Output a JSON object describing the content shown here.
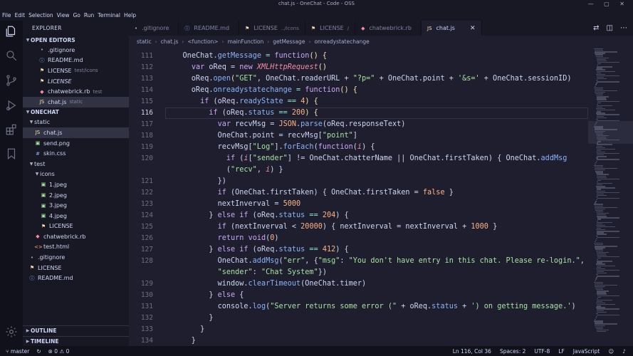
{
  "window": {
    "title": "chat.js - OneChat - Code - OSS",
    "controls": "— ▢ ✕"
  },
  "menu": [
    "File",
    "Edit",
    "Selection",
    "View",
    "Go",
    "Run",
    "Terminal",
    "Help"
  ],
  "sidebar": {
    "header": "EXPLORER",
    "open_editors_title": "OPEN EDITORS",
    "open_editors": [
      {
        "name": ".gitignore",
        "desc": "",
        "icon": "•",
        "color": "#a6adc8"
      },
      {
        "name": "README.md",
        "desc": "",
        "icon": "ⓘ",
        "color": "#89b4fa"
      },
      {
        "name": "LICENSE",
        "desc": "test/icons",
        "icon": "⚑",
        "color": "#f9e2af"
      },
      {
        "name": "LICENSE",
        "desc": "",
        "icon": "⚑",
        "color": "#f9e2af",
        "italic": true
      },
      {
        "name": "chatwebrick.rb",
        "desc": "test",
        "icon": "◆",
        "color": "#f38ba8"
      },
      {
        "name": "chat.js",
        "desc": "static",
        "icon": "JS",
        "color": "#f9e2af"
      }
    ],
    "project_title": "ONECHAT",
    "tree": [
      {
        "depth": 1,
        "type": "folder",
        "name": "static"
      },
      {
        "depth": 2,
        "type": "file",
        "name": "chat.js",
        "icon": "JS",
        "color": "#f9e2af"
      },
      {
        "depth": 2,
        "type": "file",
        "name": "send.png",
        "icon": "▣",
        "color": "#a6e3a1"
      },
      {
        "depth": 2,
        "type": "file",
        "name": "skin.css",
        "icon": "#",
        "color": "#89b4fa"
      },
      {
        "depth": 1,
        "type": "folder",
        "name": "test"
      },
      {
        "depth": 2,
        "type": "folder",
        "name": "icons"
      },
      {
        "depth": 3,
        "type": "file",
        "name": "1.jpeg",
        "icon": "▣",
        "color": "#a6e3a1"
      },
      {
        "depth": 3,
        "type": "file",
        "name": "2.jpeg",
        "icon": "▣",
        "color": "#a6e3a1"
      },
      {
        "depth": 3,
        "type": "file",
        "name": "3.jpeg",
        "icon": "▣",
        "color": "#a6e3a1"
      },
      {
        "depth": 3,
        "type": "file",
        "name": "4.jpeg",
        "icon": "▣",
        "color": "#a6e3a1"
      },
      {
        "depth": 3,
        "type": "file",
        "name": "LICENSE",
        "icon": "⚑",
        "color": "#f9e2af"
      },
      {
        "depth": 2,
        "type": "file",
        "name": "chatwebrick.rb",
        "icon": "◆",
        "color": "#f38ba8"
      },
      {
        "depth": 2,
        "type": "file",
        "name": "test.html",
        "icon": "<>",
        "color": "#fab387"
      },
      {
        "depth": 1,
        "type": "file",
        "name": ".gitignore",
        "icon": "•",
        "color": "#a6adc8"
      },
      {
        "depth": 1,
        "type": "file",
        "name": "LICENSE",
        "icon": "⚑",
        "color": "#f9e2af"
      },
      {
        "depth": 1,
        "type": "file",
        "name": "README.md",
        "icon": "ⓘ",
        "color": "#89b4fa"
      }
    ],
    "outline": "OUTLINE",
    "timeline": "TIMELINE"
  },
  "tabs": [
    {
      "name": ".gitignore",
      "desc": "",
      "icon": "•",
      "color": "#a6adc8"
    },
    {
      "name": "README.md",
      "desc": "",
      "icon": "ⓘ",
      "color": "#89b4fa"
    },
    {
      "name": "LICENSE",
      "desc": "../icons",
      "icon": "⚑",
      "color": "#f9e2af"
    },
    {
      "name": "LICENSE",
      "desc": "/",
      "icon": "⚑",
      "color": "#f9e2af"
    },
    {
      "name": "chatwebrick.rb",
      "desc": "",
      "icon": "◆",
      "color": "#f38ba8"
    },
    {
      "name": "chat.js",
      "desc": "",
      "icon": "JS",
      "color": "#f9e2af",
      "active": true
    }
  ],
  "breadcrumb": [
    "static",
    "chat.js",
    "<function>",
    "mainFunction",
    "getMessage",
    "onreadystatechange"
  ],
  "editor": {
    "current_line": 116,
    "lines": [
      {
        "n": "111",
        "code": [
          [
            "    ",
            ""
          ],
          [
            "OneChat",
            ""
          ],
          [
            ".",
            ""
          ],
          [
            "getMessage",
            "f"
          ],
          [
            " = ",
            "p"
          ],
          [
            "function",
            "k"
          ],
          [
            "() {",
            "y"
          ]
        ]
      },
      {
        "n": "112",
        "code": [
          [
            "      ",
            ""
          ],
          [
            "var",
            "k"
          ],
          [
            " oReq = ",
            ""
          ],
          [
            "new",
            "k"
          ],
          [
            " ",
            ""
          ],
          [
            "XMLHttpRequest",
            "v"
          ],
          [
            "()",
            "y"
          ]
        ]
      },
      {
        "n": "113",
        "code": [
          [
            "      oReq.",
            ""
          ],
          [
            "open",
            "f"
          ],
          [
            "(",
            "y"
          ],
          [
            "\"GET\"",
            "s"
          ],
          [
            ", OneChat.readerURL + ",
            ""
          ],
          [
            "\"?p=\"",
            "s"
          ],
          [
            " + OneChat.point + ",
            ""
          ],
          [
            "'&s='",
            "s"
          ],
          [
            " + OneChat.sessionID)",
            ""
          ]
        ]
      },
      {
        "n": "114",
        "code": [
          [
            "      oReq.",
            ""
          ],
          [
            "onreadystatechange",
            "f"
          ],
          [
            " = ",
            "p"
          ],
          [
            "function",
            "k"
          ],
          [
            "() {",
            "y"
          ]
        ]
      },
      {
        "n": "115",
        "code": [
          [
            "        ",
            ""
          ],
          [
            "if",
            "k"
          ],
          [
            " (oReq.",
            ""
          ],
          [
            "readyState",
            "f"
          ],
          [
            " == ",
            "p"
          ],
          [
            "4",
            "n"
          ],
          [
            ") {",
            "y"
          ]
        ]
      },
      {
        "n": "116",
        "code": [
          [
            "          ",
            ""
          ],
          [
            "if",
            "k"
          ],
          [
            " (oReq.",
            ""
          ],
          [
            "status",
            "f"
          ],
          [
            " == ",
            "p"
          ],
          [
            "200",
            "n"
          ],
          [
            ") {",
            "y"
          ]
        ]
      },
      {
        "n": "117",
        "code": [
          [
            "            ",
            ""
          ],
          [
            "var",
            "k"
          ],
          [
            " recvMsg = ",
            ""
          ],
          [
            "JSON",
            "n"
          ],
          [
            ".",
            ""
          ],
          [
            "parse",
            "f"
          ],
          [
            "(oReq.responseText)",
            ""
          ]
        ]
      },
      {
        "n": "118",
        "code": [
          [
            "            OneChat.point = recvMsg[",
            ""
          ],
          [
            "\"point\"",
            "s"
          ],
          [
            "]",
            ""
          ]
        ]
      },
      {
        "n": "119",
        "code": [
          [
            "            recvMsg[",
            ""
          ],
          [
            "\"Log\"",
            "s"
          ],
          [
            "].",
            ""
          ],
          [
            "forEach",
            "f"
          ],
          [
            "(",
            ""
          ],
          [
            "function",
            "k"
          ],
          [
            "(",
            ""
          ],
          [
            "i",
            "v"
          ],
          [
            ") {",
            ""
          ]
        ]
      },
      {
        "n": "120",
        "code": [
          [
            "              ",
            ""
          ],
          [
            "if",
            "k"
          ],
          [
            " (",
            ""
          ],
          [
            "i",
            "v"
          ],
          [
            "[",
            ""
          ],
          [
            "\"sender\"",
            "s"
          ],
          [
            "] != OneChat.chatterName || OneChat.firstTaken) { OneChat.",
            ""
          ],
          [
            "addMsg",
            "f"
          ]
        ]
      },
      {
        "n": "",
        "code": [
          [
            "              (",
            ""
          ],
          [
            "\"recv\"",
            "s"
          ],
          [
            ", ",
            ""
          ],
          [
            "i",
            "v"
          ],
          [
            ") }",
            ""
          ]
        ]
      },
      {
        "n": "121",
        "code": [
          [
            "            })",
            ""
          ]
        ]
      },
      {
        "n": "122",
        "code": [
          [
            "            ",
            ""
          ],
          [
            "if",
            "k"
          ],
          [
            " (OneChat.firstTaken) { OneChat.firstTaken = ",
            ""
          ],
          [
            "false",
            "n"
          ],
          [
            " }",
            ""
          ]
        ]
      },
      {
        "n": "123",
        "code": [
          [
            "            nextInverval = ",
            ""
          ],
          [
            "5000",
            "n"
          ]
        ]
      },
      {
        "n": "124",
        "code": [
          [
            "          } ",
            ""
          ],
          [
            "else if",
            "k"
          ],
          [
            " (oReq.",
            ""
          ],
          [
            "status",
            "f"
          ],
          [
            " == ",
            "p"
          ],
          [
            "204",
            "n"
          ],
          [
            ") {",
            ""
          ]
        ]
      },
      {
        "n": "125",
        "code": [
          [
            "            ",
            ""
          ],
          [
            "if",
            "k"
          ],
          [
            " (nextInverval < ",
            ""
          ],
          [
            "20000",
            "n"
          ],
          [
            ") { nextInverval = nextInverval + ",
            ""
          ],
          [
            "1000",
            "n"
          ],
          [
            " }",
            ""
          ]
        ]
      },
      {
        "n": "126",
        "code": [
          [
            "            ",
            ""
          ],
          [
            "return",
            "k"
          ],
          [
            " ",
            ""
          ],
          [
            "void",
            "k"
          ],
          [
            "(",
            ""
          ],
          [
            "0",
            "n"
          ],
          [
            ")",
            ""
          ]
        ]
      },
      {
        "n": "127",
        "code": [
          [
            "          } ",
            ""
          ],
          [
            "else if",
            "k"
          ],
          [
            " (oReq.",
            ""
          ],
          [
            "status",
            "f"
          ],
          [
            " == ",
            "p"
          ],
          [
            "412",
            "n"
          ],
          [
            ") {",
            ""
          ]
        ]
      },
      {
        "n": "128",
        "code": [
          [
            "            OneChat.",
            ""
          ],
          [
            "addMsg",
            "f"
          ],
          [
            "(",
            ""
          ],
          [
            "\"err\"",
            "s"
          ],
          [
            ", {",
            ""
          ],
          [
            "\"msg\"",
            "s"
          ],
          [
            ": ",
            ""
          ],
          [
            "\"You don't have entry in this chat. Please re-login.\"",
            "s"
          ],
          [
            ",",
            ""
          ]
        ]
      },
      {
        "n": "",
        "code": [
          [
            "            ",
            ""
          ],
          [
            "\"sender\"",
            "s"
          ],
          [
            ": ",
            ""
          ],
          [
            "\"Chat System\"",
            "s"
          ],
          [
            "})",
            ""
          ]
        ]
      },
      {
        "n": "129",
        "code": [
          [
            "            window.",
            ""
          ],
          [
            "clearTimeout",
            "f"
          ],
          [
            "(OneChat.timer)",
            ""
          ]
        ]
      },
      {
        "n": "130",
        "code": [
          [
            "          } ",
            ""
          ],
          [
            "else",
            "k"
          ],
          [
            " {",
            ""
          ]
        ]
      },
      {
        "n": "131",
        "code": [
          [
            "            console.",
            ""
          ],
          [
            "log",
            "f"
          ],
          [
            "(",
            ""
          ],
          [
            "\"Server returns some error (\"",
            "s"
          ],
          [
            " + oReq.",
            ""
          ],
          [
            "status",
            "f"
          ],
          [
            " + ",
            ""
          ],
          [
            "') on getting message.'",
            "s"
          ],
          [
            ")",
            ""
          ]
        ]
      },
      {
        "n": "132",
        "code": [
          [
            "          }",
            ""
          ]
        ]
      },
      {
        "n": "133",
        "code": [
          [
            "        }",
            ""
          ]
        ]
      },
      {
        "n": "134",
        "code": [
          [
            "      }",
            ""
          ]
        ]
      }
    ]
  },
  "status": {
    "branch": "master",
    "sync": "↻",
    "problems": "⊗ 0 ⚠ 0",
    "position": "Ln 116, Col 36",
    "spaces": "Spaces: 2",
    "encoding": "UTF-8",
    "eol": "LF",
    "language": "JavaScript",
    "feedback": "☺",
    "bell": "♪"
  }
}
